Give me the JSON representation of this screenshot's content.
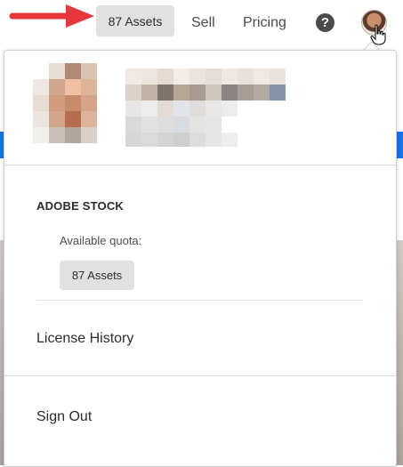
{
  "nav": {
    "assets_label": "87 Assets",
    "sell_label": "Sell",
    "pricing_label": "Pricing",
    "help_glyph": "?"
  },
  "dropdown": {
    "section_title": "ADOBE STOCK",
    "quota_label": "Available quota:",
    "quota_badge": "87 Assets",
    "license_history": "License History",
    "sign_out": "Sign Out"
  },
  "colors": {
    "accent_blue": "#1473e6",
    "arrow_red": "#e8363d",
    "badge_bg": "#e1e1e1"
  },
  "icons": {
    "help": "help-circle-icon",
    "avatar": "user-avatar",
    "cursor": "hand-pointer-icon",
    "arrows": "red-annotation-arrow-icon"
  }
}
